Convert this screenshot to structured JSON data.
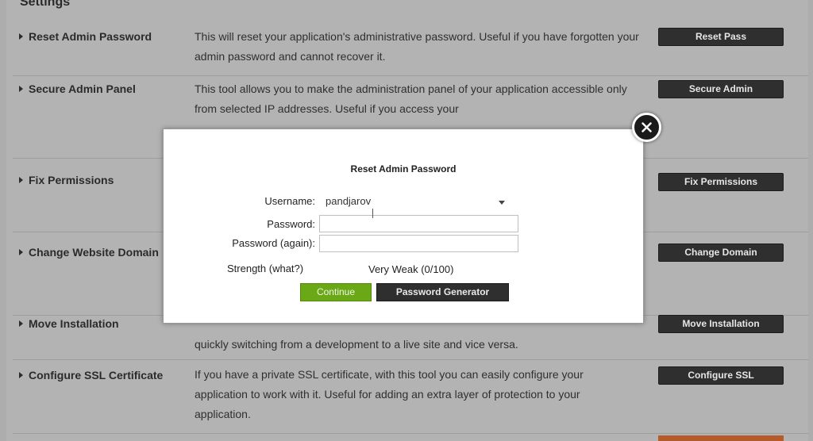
{
  "section_title": "Settings",
  "rows": [
    {
      "label": "Reset Admin Password",
      "desc": "This will reset your application's administrative password. Useful if you have forgotten your admin password and cannot recover it.",
      "button": "Reset Pass"
    },
    {
      "label": "Secure Admin Panel",
      "desc": "This tool allows you to make the administration panel of your application accessible only from selected IP addresses. Useful if you access your",
      "button": "Secure Admin"
    },
    {
      "label": "Fix Permissions",
      "desc": "",
      "button": "Fix Permissions"
    },
    {
      "label": "Change Website Domain",
      "desc": "",
      "button": "Change Domain"
    },
    {
      "label": "Move Installation",
      "desc": "quickly switching from a development to a live site and vice versa.",
      "button": "Move Installation"
    },
    {
      "label": "Configure SSL Certificate",
      "desc": "If you have a private SSL certificate, with this tool you can easily configure your application to work with it. Useful for adding an extra layer of protection to your application.",
      "button": "Configure SSL"
    }
  ],
  "modal": {
    "title": "Reset Admin Password",
    "username_label": "Username:",
    "username_value": "pandjarov",
    "password_label": "Password:",
    "password_value": "",
    "password_again_label": "Password (again):",
    "password_again_value": "",
    "strength_label": "Strength (what?)",
    "strength_value": "Very Weak (0/100)",
    "continue_label": "Continue",
    "generator_label": "Password Generator"
  },
  "colors": {
    "accent_green": "#6aa816",
    "button_dark": "#2f2f2f",
    "orange": "#b55a2a"
  },
  "icons": {
    "close": "close-icon",
    "row_arrow": "triangle-right-icon",
    "dropdown": "chevron-down-icon"
  }
}
